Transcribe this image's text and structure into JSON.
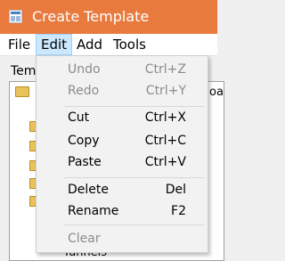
{
  "window": {
    "title": "Create Template"
  },
  "menubar": {
    "items": [
      {
        "label": "File"
      },
      {
        "label": "Edit",
        "active": true
      },
      {
        "label": "Add"
      },
      {
        "label": "Tools"
      }
    ]
  },
  "background": {
    "label": "Tem",
    "trailing_text": "oa",
    "bottom_text": "Tunnels"
  },
  "edit_menu": {
    "items": [
      {
        "label": "Undo",
        "shortcut": "Ctrl+Z",
        "enabled": false
      },
      {
        "label": "Redo",
        "shortcut": "Ctrl+Y",
        "enabled": false
      },
      {
        "label": "Cut",
        "shortcut": "Ctrl+X",
        "enabled": true
      },
      {
        "label": "Copy",
        "shortcut": "Ctrl+C",
        "enabled": true
      },
      {
        "label": "Paste",
        "shortcut": "Ctrl+V",
        "enabled": true
      },
      {
        "label": "Delete",
        "shortcut": "Del",
        "enabled": true
      },
      {
        "label": "Rename",
        "shortcut": "F2",
        "enabled": true
      },
      {
        "label": "Clear",
        "shortcut": "",
        "enabled": false
      }
    ]
  },
  "colors": {
    "titlebar": "#e87a3e",
    "menu_highlight": "#cce8ff",
    "disabled_text": "#8c8c8c"
  }
}
